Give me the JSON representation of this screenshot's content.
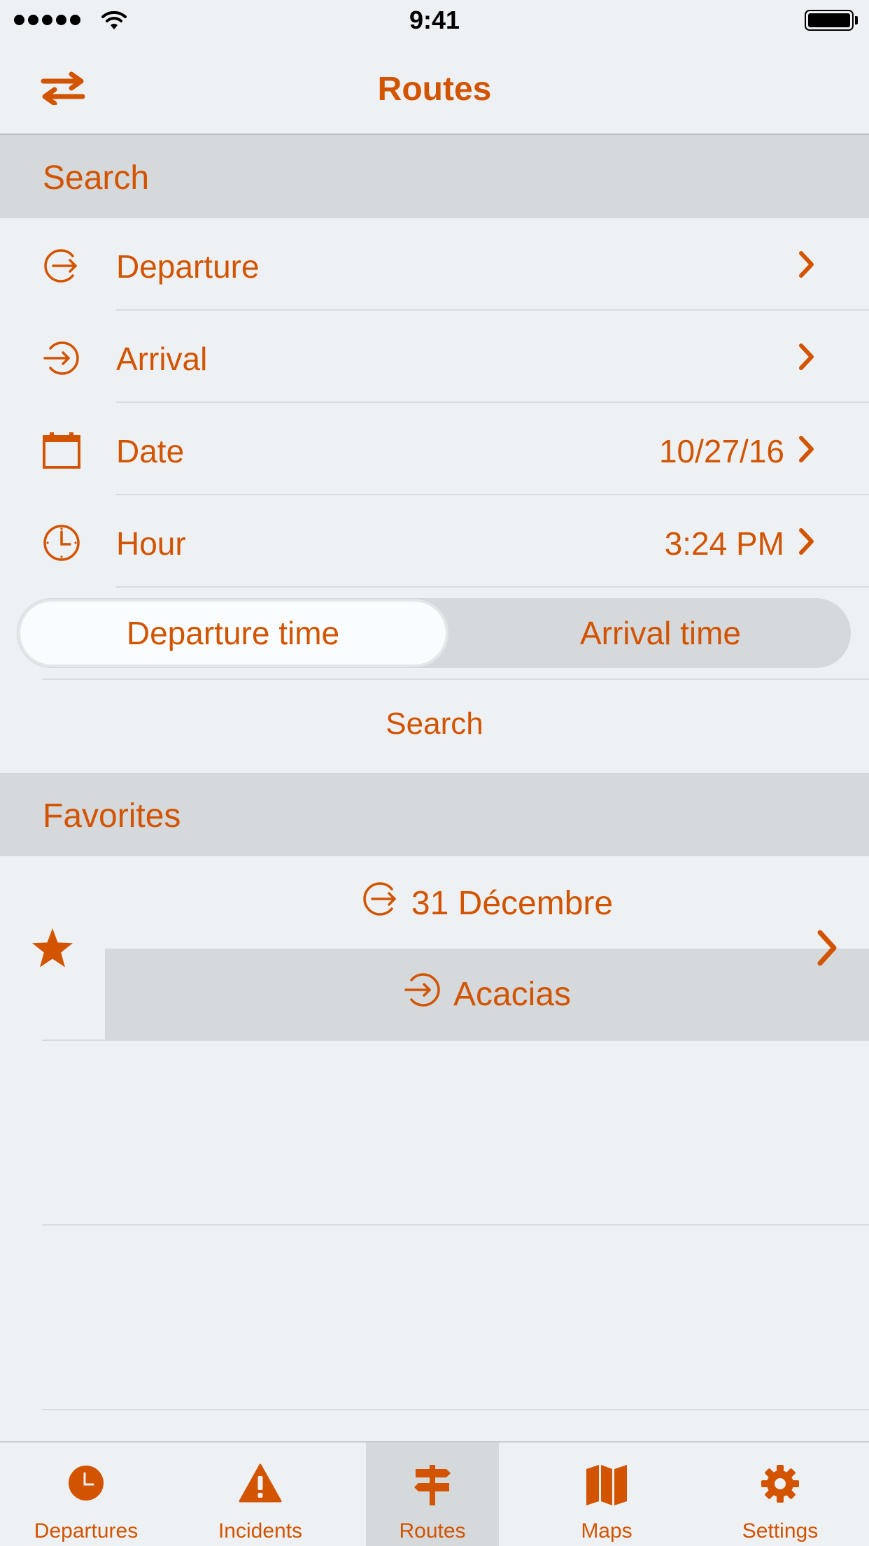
{
  "status_bar": {
    "time": "9:41"
  },
  "nav": {
    "title": "Routes",
    "left_icon": "swap-arrows-icon"
  },
  "search_section": {
    "header": "Search",
    "rows": [
      {
        "label": "Departure",
        "value": "",
        "icon": "departure-icon"
      },
      {
        "label": "Arrival",
        "value": "",
        "icon": "arrival-icon"
      },
      {
        "label": "Date",
        "value": "10/27/16",
        "icon": "calendar-icon"
      },
      {
        "label": "Hour",
        "value": "3:24 PM",
        "icon": "clock-icon"
      }
    ],
    "segmented": {
      "options": [
        "Departure time",
        "Arrival time"
      ],
      "selected": "Departure time"
    },
    "search_button": "Search"
  },
  "favorites_section": {
    "header": "Favorites",
    "items": [
      {
        "from": "31 Décembre",
        "to": "Acacias"
      }
    ]
  },
  "tab_bar": {
    "tabs": [
      {
        "label": "Departures",
        "icon": "clock-icon"
      },
      {
        "label": "Incidents",
        "icon": "warning-icon"
      },
      {
        "label": "Routes",
        "icon": "signpost-icon"
      },
      {
        "label": "Maps",
        "icon": "map-icon"
      },
      {
        "label": "Settings",
        "icon": "gear-icon"
      }
    ],
    "active": "Routes"
  },
  "colors": {
    "accent": "#d35400",
    "background": "#eef1f3",
    "section": "#d5d9db"
  }
}
